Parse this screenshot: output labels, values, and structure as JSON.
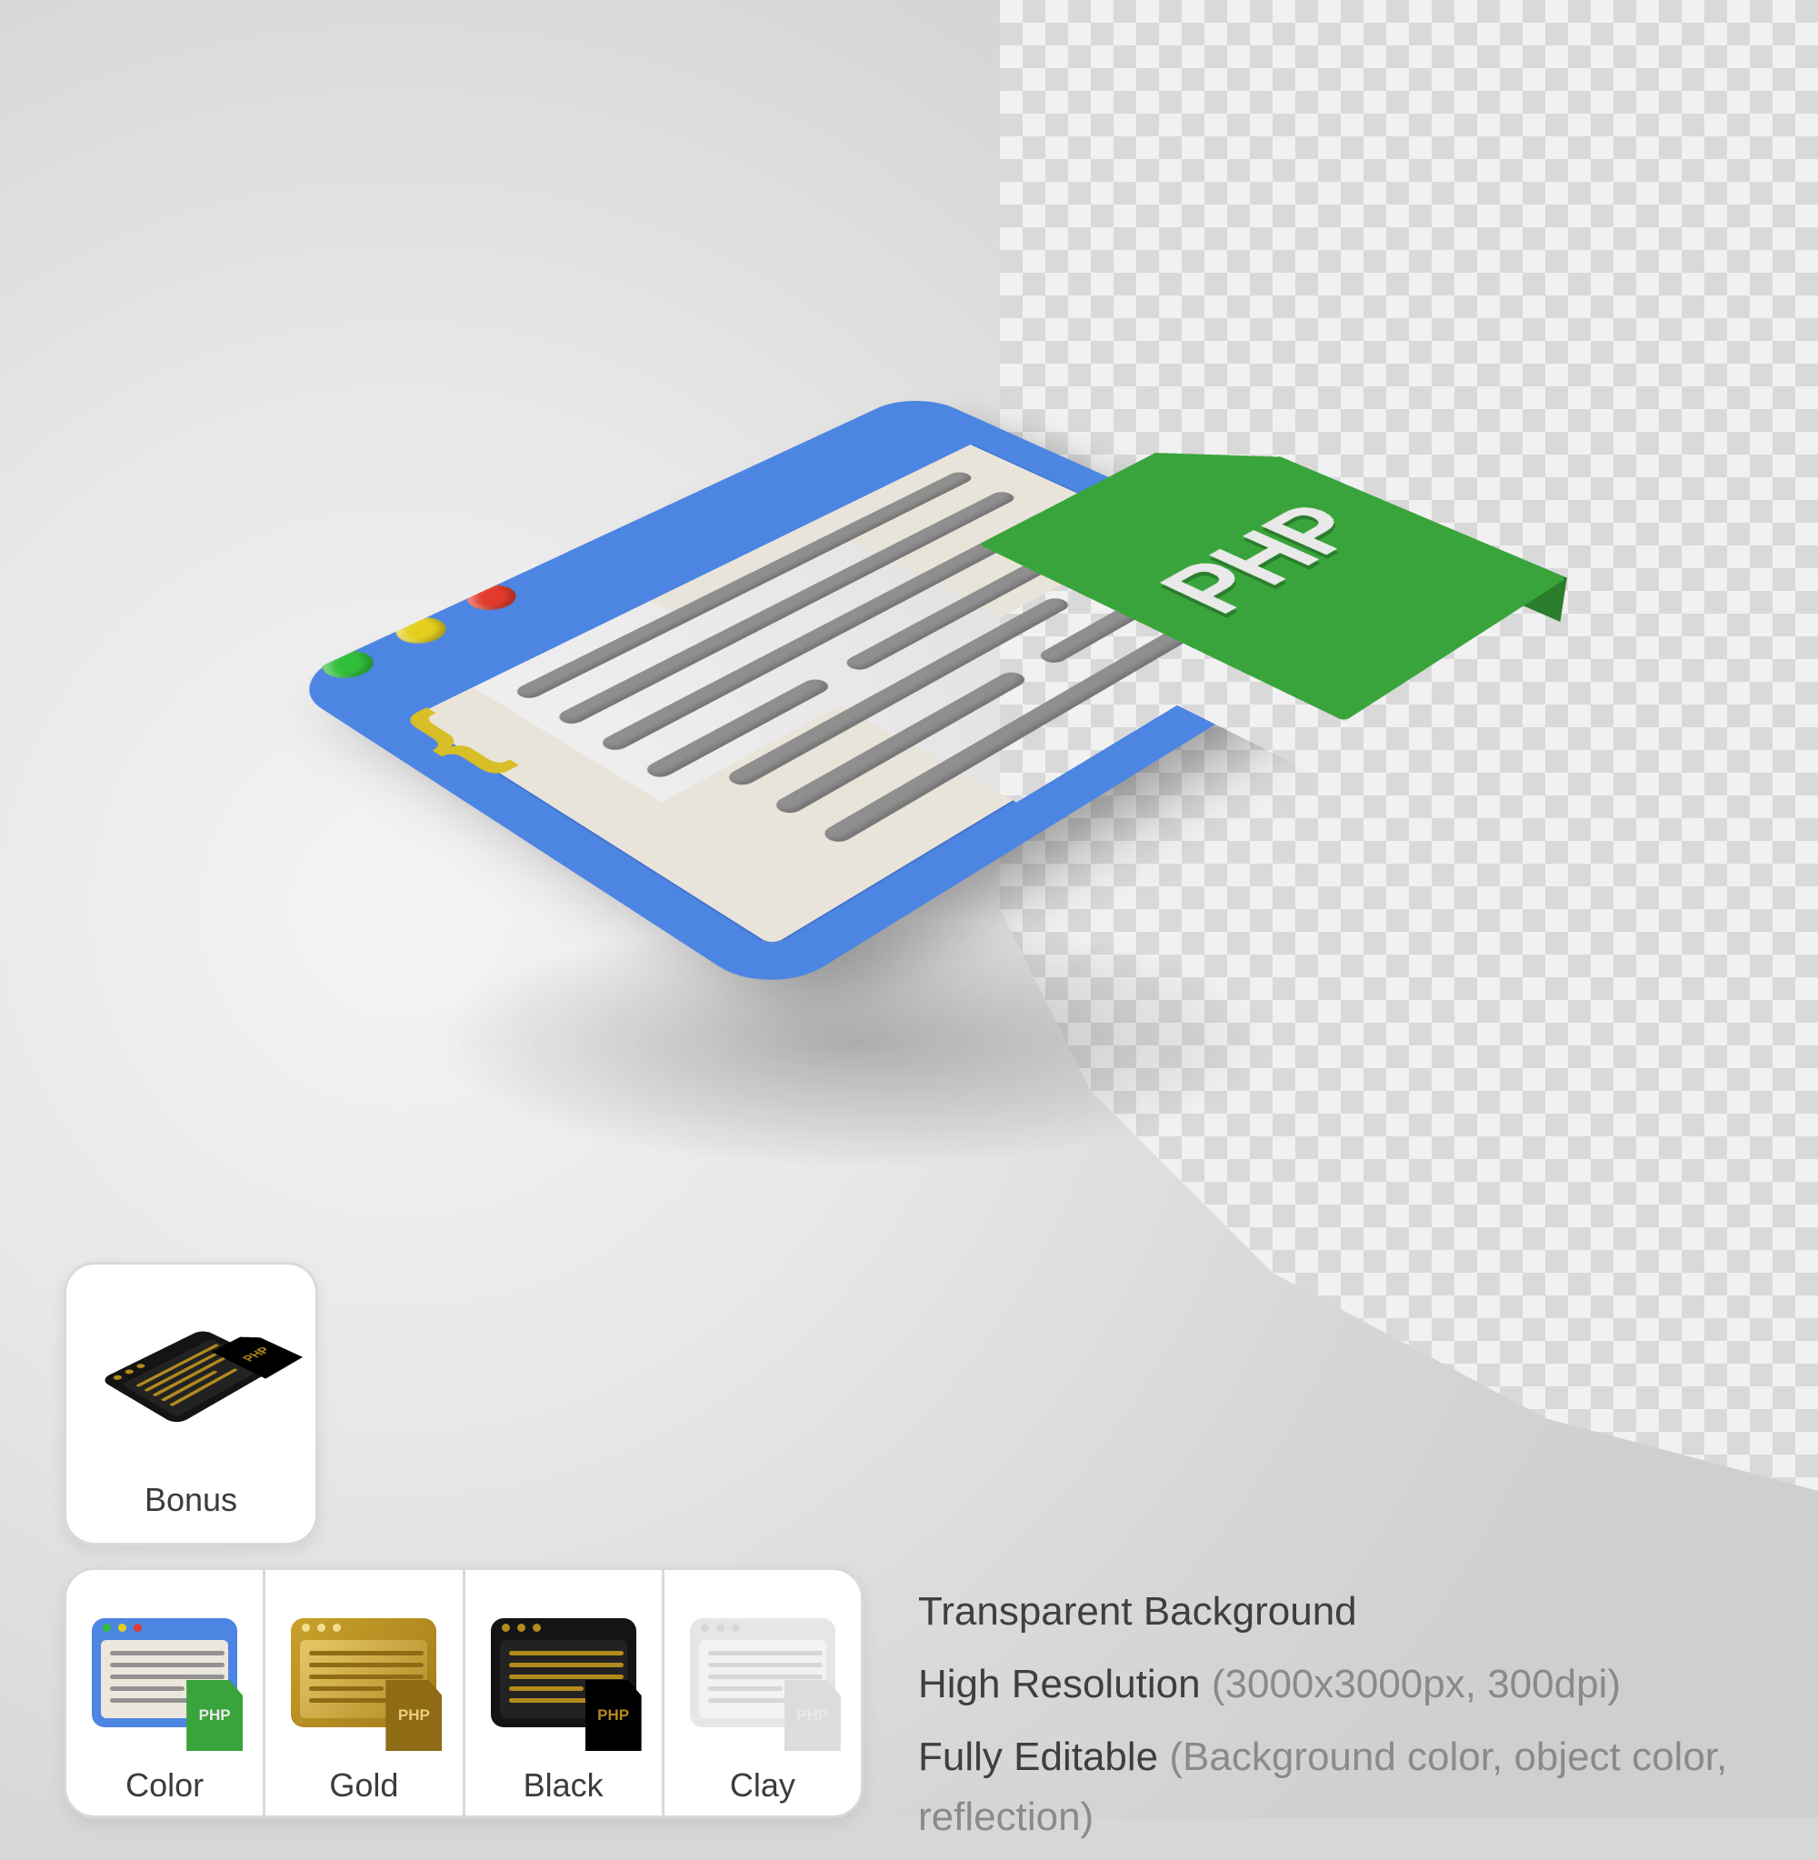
{
  "hero_file_label": "PHP",
  "bonus": {
    "label": "Bonus",
    "mini_tag": "PHP"
  },
  "variants": [
    {
      "label": "Color",
      "class": "v-color",
      "mini_tag": "PHP"
    },
    {
      "label": "Gold",
      "class": "v-gold",
      "mini_tag": "PHP"
    },
    {
      "label": "Black",
      "class": "v-black",
      "mini_tag": "PHP"
    },
    {
      "label": "Clay",
      "class": "v-clay",
      "mini_tag": "PHP"
    }
  ],
  "features": {
    "f1_lead": "Transparent Background",
    "f2_lead": "High Resolution ",
    "f2_paren": "(3000x3000px, 300dpi)",
    "f3_lead": "Fully Editable ",
    "f3_paren": "(Background color, object color, reflection)"
  }
}
